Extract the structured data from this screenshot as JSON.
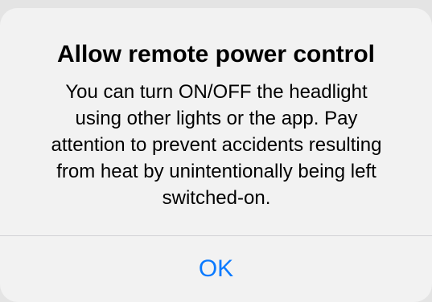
{
  "dialog": {
    "title": "Allow remote power control",
    "message": "You can turn ON/OFF the headlight\nusing other lights or the app. Pay\nattention to prevent accidents resulting\nfrom heat by unintentionally being left\nswitched-on.",
    "ok_label": "OK"
  },
  "colors": {
    "dialog_background": "#f2f2f2",
    "backdrop": "#e4e4e4",
    "button_text": "#0a7aff",
    "divider": "#d2d2d6",
    "text": "#000000"
  }
}
